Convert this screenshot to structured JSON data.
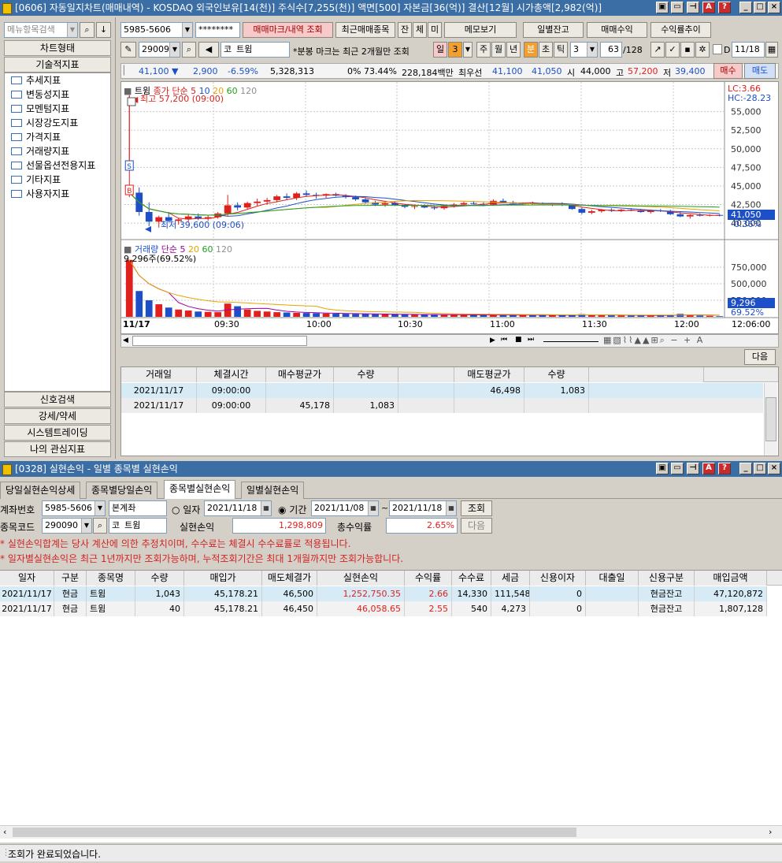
{
  "chart_window": {
    "title": "[0606] 자동일지차트(매매내역) - KOSDAQ 외국인보유[14(천)] 주식수[7,255(천)] 액면[500] 자본금[36(억)] 결산[12월] 시가총액[2,982(억)]",
    "sidebar": {
      "search_placeholder": "메뉴항목검색",
      "tabs_top": [
        "차트형태",
        "기술적지표"
      ],
      "tree_items": [
        "추세지표",
        "변동성지표",
        "모멘텀지표",
        "시장강도지표",
        "가격지표",
        "거래량지표",
        "선물옵션전용지표",
        "기타지표",
        "사용자지표"
      ],
      "tabs_bottom": [
        "신호검색",
        "강세/약세",
        "시스템트레이딩",
        "나의 관심지표"
      ]
    },
    "toolbar1": {
      "account": "5985-5606",
      "password": "********",
      "mark_button": "매매마크/내역 조회",
      "recent_button": "최근매매종목",
      "small_tabs": [
        "잔",
        "체",
        "미"
      ],
      "memo_button": "메모보기",
      "daily_balance_button": "일별잔고",
      "trade_profit_button": "매매수익",
      "return_trend_button": "수익률추이"
    },
    "toolbar2": {
      "code": "290090",
      "market_tag": "코",
      "name": "트윔",
      "notice": "*분봉 마크는 최근 2개월만 조회",
      "period_buttons": [
        "일",
        "3",
        "주",
        "월",
        "년",
        "분",
        "초",
        "틱"
      ],
      "interval": "3",
      "count": "63",
      "count_total": "/128",
      "date": "11/18"
    },
    "quote": {
      "price": "41,100",
      "change": "2,900",
      "change_pct": "-6.59%",
      "volume": "5,328,313",
      "ratio": "0% 73.44%",
      "amount": "228,184백만",
      "best_label": "최우선",
      "ask": "41,100",
      "bid": "41,050",
      "open_label": "시",
      "open": "44,000",
      "high_label": "고",
      "high": "57,200",
      "low_label": "저",
      "low": "39,400",
      "buy_button": "매수",
      "sell_button": "매도"
    },
    "price_chart": {
      "legend_name": "트윔",
      "legend_ma": "종가 단순",
      "legend_periods": [
        "5",
        "10",
        "20",
        "60",
        "120"
      ],
      "high_annotation": "최고 57,200 (09:00)",
      "low_annotation": "최저 39,600 (09:06)",
      "lc_label": "LC:3.66",
      "hc_label": "HC:-28.23",
      "current_price_tag": "41,050",
      "current_pct_tag": "-0.36%",
      "y_ticks": [
        "55,000",
        "52,500",
        "50,000",
        "47,500",
        "45,000",
        "42,500",
        "40,000"
      ]
    },
    "volume_chart": {
      "legend_name": "거래량",
      "legend_ma": "단순",
      "legend_periods": [
        "5",
        "20",
        "60",
        "120"
      ],
      "info": "9,296주(69.52%)",
      "y_ticks": [
        "750,000",
        "500,000",
        "250,000"
      ],
      "current_tag": "9,296",
      "current_pct_tag": "69.52%"
    },
    "x_ticks": [
      "11/17",
      "09:30",
      "10:00",
      "10:30",
      "11:00",
      "11:30",
      "12:00",
      "12:06:00"
    ],
    "trade_table": {
      "next_button": "다음",
      "headers": [
        "거래일",
        "체결시간",
        "매수평균가",
        "수량",
        "",
        "매도평균가",
        "수량"
      ],
      "rows": [
        [
          "2021/11/17",
          "09:00:00",
          "",
          "",
          "",
          "46,498",
          "1,083"
        ],
        [
          "2021/11/17",
          "09:00:00",
          "45,178",
          "1,083",
          "",
          "",
          ""
        ]
      ]
    }
  },
  "pnl_window": {
    "title": "[0328] 실현손익 - 일별 종목별 실현손익",
    "tabs": [
      "당일실현손익상세",
      "종목별당일손익",
      "종목별실현손익",
      "일별실현손익"
    ],
    "active_tab": 2,
    "form": {
      "account_label": "계좌번호",
      "account": "5985-5606",
      "account_type": "본계좌",
      "date_radio_label": "일자",
      "date": "2021/11/18",
      "period_radio_label": "기간",
      "period_from": "2021/11/08",
      "period_sep": "~",
      "period_to": "2021/11/18",
      "query_button": "조회",
      "code_label": "종목코드",
      "code": "290090",
      "market_tag": "코",
      "name": "트윔",
      "realized_label": "실현손익",
      "realized_value": "1,298,809",
      "total_return_label": "총수익률",
      "total_return_value": "2.65%",
      "next_button": "다음"
    },
    "notices": [
      "* 실현손익합계는 당사 계산에 의한 추정치이며, 수수료는 체결시 수수료률로 적용됩니다.",
      "* 일자별실현손익은 최근 1년까지만 조회가능하며, 누적조회기간은 최대 1개월까지만 조회가능합니다."
    ],
    "table": {
      "headers": [
        "일자",
        "구분",
        "종목명",
        "수량",
        "매입가",
        "매도체결가",
        "실현손익",
        "수익률",
        "수수료",
        "세금",
        "신용이자",
        "대출일",
        "신용구분",
        "매입금액"
      ],
      "rows": [
        [
          "2021/11/17",
          "현금",
          "트윔",
          "1,043",
          "45,178.21",
          "46,500",
          "1,252,750.35",
          "2.66",
          "14,330",
          "111,548",
          "0",
          "",
          "현금잔고",
          "47,120,872"
        ],
        [
          "2021/11/17",
          "현금",
          "트윔",
          "40",
          "45,178.21",
          "46,450",
          "46,058.65",
          "2.55",
          "540",
          "4,273",
          "0",
          "",
          "현금잔고",
          "1,807,128"
        ]
      ]
    },
    "status": "조회가 완료되었습니다."
  },
  "colors": {
    "title_bar": "#3b6ea5",
    "up": "#e0201c",
    "down": "#1c4fc8",
    "ma5": "#e0201c",
    "ma10": "#1c4fc8",
    "ma20": "#e8a400",
    "ma60": "#20a020",
    "ma120": "#909090"
  },
  "chart_data": {
    "type": "candlestick",
    "price_range": [
      38000,
      57500
    ],
    "volume_range": [
      0,
      1000000
    ],
    "candles": [
      [
        44000,
        57200,
        43500,
        44100
      ],
      [
        44100,
        44800,
        41000,
        41500
      ],
      [
        41500,
        42800,
        39600,
        40200
      ],
      [
        40200,
        41000,
        39400,
        40800
      ],
      [
        40800,
        41500,
        40100,
        40300
      ],
      [
        40300,
        40700,
        39800,
        40500
      ],
      [
        40500,
        41200,
        40200,
        40900
      ],
      [
        40900,
        41300,
        40400,
        40600
      ],
      [
        40600,
        41100,
        40300,
        40800
      ],
      [
        40800,
        41500,
        40600,
        41300
      ],
      [
        41300,
        43800,
        41000,
        42400
      ],
      [
        42400,
        42800,
        41700,
        42100
      ],
      [
        42100,
        42900,
        41800,
        42700
      ],
      [
        42700,
        43300,
        42300,
        42900
      ],
      [
        42900,
        43400,
        42500,
        43100
      ],
      [
        43100,
        43800,
        42800,
        43600
      ],
      [
        43600,
        44000,
        43100,
        43400
      ],
      [
        43400,
        44200,
        43100,
        44000
      ],
      [
        44000,
        44400,
        43600,
        43800
      ],
      [
        43800,
        44100,
        43300,
        43700
      ],
      [
        43700,
        44000,
        43400,
        43900
      ],
      [
        43900,
        44100,
        43600,
        43700
      ],
      [
        43700,
        43900,
        43300,
        43500
      ],
      [
        43500,
        43700,
        43000,
        43200
      ],
      [
        43200,
        43400,
        42600,
        42800
      ],
      [
        42800,
        43000,
        42300,
        42500
      ],
      [
        42500,
        42900,
        42200,
        42700
      ],
      [
        42700,
        42900,
        42300,
        42400
      ],
      [
        42400,
        42600,
        42000,
        42200
      ],
      [
        42200,
        42500,
        41900,
        42300
      ],
      [
        42300,
        42500,
        42000,
        42100
      ],
      [
        42100,
        42300,
        41800,
        42000
      ],
      [
        42000,
        42400,
        41800,
        42300
      ],
      [
        42300,
        42700,
        42100,
        42500
      ],
      [
        42500,
        42900,
        42300,
        42700
      ],
      [
        42700,
        43000,
        42500,
        42600
      ],
      [
        42600,
        42800,
        42300,
        42500
      ],
      [
        42500,
        43200,
        42400,
        43000
      ],
      [
        43000,
        43300,
        42700,
        42800
      ],
      [
        42800,
        43000,
        42500,
        42600
      ],
      [
        42600,
        42800,
        42400,
        42700
      ],
      [
        42700,
        42900,
        42500,
        42600
      ],
      [
        42600,
        42800,
        42400,
        42500
      ],
      [
        42500,
        42700,
        42300,
        42600
      ],
      [
        42600,
        42800,
        42300,
        42400
      ],
      [
        42400,
        42600,
        41800,
        41900
      ],
      [
        41900,
        42100,
        41200,
        41400
      ],
      [
        41400,
        41800,
        41200,
        41600
      ],
      [
        41600,
        41900,
        41400,
        41800
      ],
      [
        41800,
        42000,
        41500,
        41700
      ],
      [
        41700,
        41900,
        41500,
        41800
      ],
      [
        41800,
        42000,
        41600,
        41700
      ],
      [
        41700,
        41900,
        41400,
        41500
      ],
      [
        41500,
        41800,
        41300,
        41700
      ],
      [
        41700,
        41900,
        41500,
        41600
      ],
      [
        41600,
        41800,
        41100,
        41200
      ],
      [
        41200,
        41500,
        40800,
        40900
      ],
      [
        40900,
        41200,
        40600,
        41100
      ],
      [
        41100,
        41300,
        40900,
        41000
      ],
      [
        41000,
        41200,
        40900,
        41100
      ],
      [
        41100,
        41200,
        40900,
        41050
      ]
    ],
    "volumes": [
      860000,
      390000,
      250000,
      190000,
      140000,
      110000,
      95000,
      80000,
      75000,
      70000,
      200000,
      160000,
      110000,
      90000,
      80000,
      70000,
      65000,
      60000,
      58000,
      55000,
      50000,
      48000,
      46000,
      44000,
      42000,
      40000,
      38000,
      36000,
      35000,
      34000,
      33000,
      32000,
      31000,
      30000,
      30000,
      29000,
      28000,
      28000,
      27000,
      27000,
      26000,
      26000,
      25000,
      25000,
      25000,
      24000,
      40000,
      30000,
      24000,
      23000,
      22000,
      22000,
      21000,
      21000,
      20000,
      30000,
      45000,
      28000,
      20000,
      15000,
      9296
    ]
  }
}
